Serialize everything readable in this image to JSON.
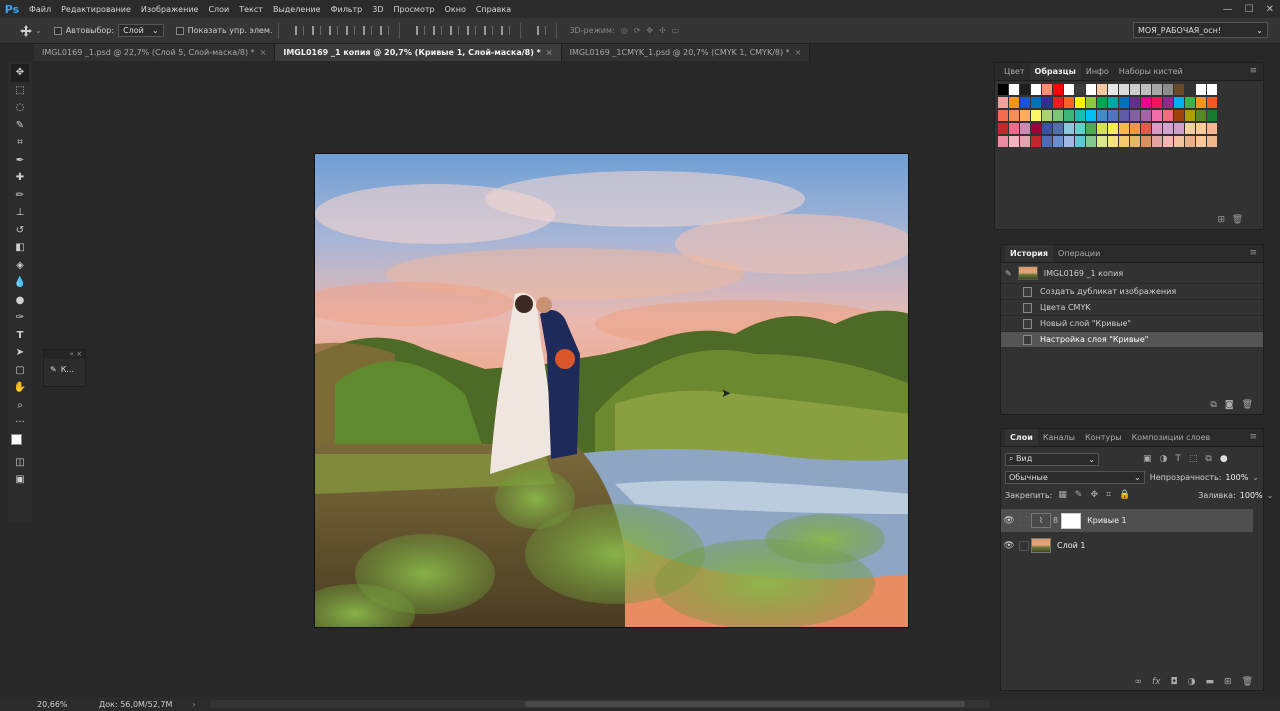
{
  "app": {
    "logo": "Ps"
  },
  "menu": [
    "Файл",
    "Редактирование",
    "Изображение",
    "Слои",
    "Текст",
    "Выделение",
    "Фильтр",
    "3D",
    "Просмотр",
    "Окно",
    "Справка"
  ],
  "window_controls": [
    "—",
    "☐",
    "✕"
  ],
  "options": {
    "autoselect_label": "Автовыбор:",
    "autoselect_value": "Слой",
    "show_transform_label": "Показать упр. элем.",
    "mode3d_label": "3D-режим:",
    "workspace": "МОЯ_РАБОЧАЯ_осн!"
  },
  "tabs": [
    {
      "label": "IMGL0169 _1.psd @ 22,7% (Слой 5, Слой-маска/8) *",
      "active": false
    },
    {
      "label": "IMGL0169 _1 копия @ 20,7% (Кривые 1, Слой-маска/8) *",
      "active": true
    },
    {
      "label": "IMGL0169 _1CMYK_1.psd @ 20,7% (CMYK 1, CMYK/8) *",
      "active": false
    }
  ],
  "tools": [
    "move-icon",
    "marquee-icon",
    "lasso-icon",
    "magic-wand-icon",
    "crop-icon",
    "eyedropper-icon",
    "healing-icon",
    "brush-icon",
    "stamp-icon",
    "history-brush-icon",
    "eraser-icon",
    "bucket-icon",
    "blur-icon",
    "dodge-icon",
    "pen-icon",
    "type-icon",
    "path-select-icon",
    "shape-icon",
    "hand-icon",
    "zoom-icon",
    "more-tools-icon"
  ],
  "float_panel": {
    "label": "К..."
  },
  "swatches_panel": {
    "tabs": [
      "Цвет",
      "Образцы",
      "Инфо",
      "Наборы кистей"
    ],
    "active": 1,
    "rows": [
      [
        "#000000",
        "#ffffff",
        "#1e1e1e",
        "#ffffff",
        "#ff8c73",
        "#ff0000",
        "#ffffff",
        "#3d3d3d",
        "#ffffff",
        "#f5c9a4",
        "#e6e6e6",
        "#d9d9d9",
        "#cccccc",
        "#bfbfbf",
        "#a6a6a6",
        "#8c8c8c",
        "#6b4a2a",
        "#323232",
        "#ffffff",
        "#ffffff"
      ],
      [
        "#f4a0a0",
        "#f7941d",
        "#1f4fd6",
        "#0072bc",
        "#2e3192",
        "#ed1c24",
        "#f26522",
        "#fff200",
        "#8dc63f",
        "#00a651",
        "#00a99d",
        "#0072bc",
        "#662d91",
        "#ec008c",
        "#ed145b",
        "#92278f",
        "#00aeef",
        "#39b54a",
        "#f7941d",
        "#f15a24"
      ],
      [
        "#f26c4f",
        "#f68e56",
        "#fbaf5d",
        "#fff568",
        "#acd373",
        "#7cc576",
        "#3bb878",
        "#1abbb4",
        "#00bff3",
        "#438ccb",
        "#5574b9",
        "#605ca8",
        "#855fa8",
        "#a763a8",
        "#f06ea9",
        "#f26d7d",
        "#a0410d",
        "#aba000",
        "#598527",
        "#1a7b30"
      ],
      [
        "#c1272d",
        "#ed6c8c",
        "#c38fb4",
        "#9e0039",
        "#3953a4",
        "#5470a8",
        "#8cc6dc",
        "#63d0c8",
        "#4dac4f",
        "#d4e44c",
        "#fbeb57",
        "#f7b947",
        "#f79447",
        "#e8574b",
        "#da9cc7",
        "#d3a3cf",
        "#cfa0ce",
        "#f2d0a4",
        "#ffcc99",
        "#f9b490"
      ],
      [
        "#ec8aa4",
        "#f7b2c1",
        "#e7a4b0",
        "#c2272d",
        "#4b6cb7",
        "#6a8fd1",
        "#9fb9e3",
        "#5cc9d3",
        "#83c98d",
        "#d9e98a",
        "#f7e27b",
        "#f3c96c",
        "#e6b565",
        "#d99060",
        "#e6a3a3",
        "#f4b5b5",
        "#f0c2a0",
        "#e8b089",
        "#f5c89b",
        "#f1b88e"
      ]
    ]
  },
  "history_panel": {
    "tabs": [
      "История",
      "Операции"
    ],
    "snapshot": "IMGL0169 _1 копия",
    "items": [
      "Создать дубликат изображения",
      "Цвета CMYK",
      "Новый слой \"Кривые\"",
      "Настройка слоя \"Кривые\""
    ],
    "selected": 3
  },
  "layers_panel": {
    "tabs": [
      "Слои",
      "Каналы",
      "Контуры",
      "Композиции слоев"
    ],
    "filter": "Вид",
    "blend_mode": "Обычные",
    "opacity_label": "Непрозрачность:",
    "opacity_value": "100%",
    "lock_label": "Закрепить:",
    "fill_label": "Заливка:",
    "fill_value": "100%",
    "layers": [
      {
        "name": "Кривые 1",
        "selected": true
      },
      {
        "name": "Слой 1",
        "selected": false
      }
    ]
  },
  "status": {
    "zoom": "20,66%",
    "doc": "Док: 56,0M/52,7M"
  }
}
